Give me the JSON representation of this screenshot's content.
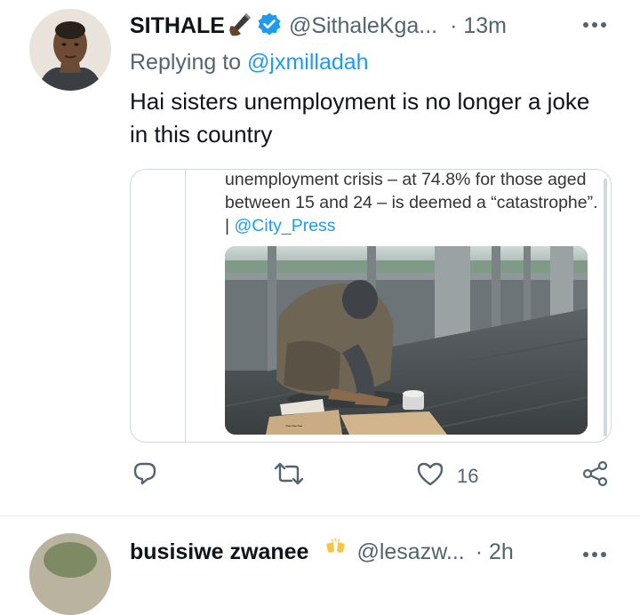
{
  "tweet": {
    "display_name": "SITHALE",
    "handle": "@SithaleKga...",
    "time": "· 13m",
    "replying_label": "Replying to",
    "replying_to": "@jxmilladah",
    "text": "Hai sisters unemployment is no longer a joke in this country",
    "name_emoji_icon": "writing-hand-icon",
    "verified_icon": "verified-badge-icon"
  },
  "quoted_card": {
    "text": "unemployment crisis – at 74.8% for those aged between 15 and 24 – is deemed a “catastrophe”. | ",
    "mention": "@City_Press"
  },
  "actions": {
    "like_count": "16"
  },
  "next_tweet": {
    "display_name": "busisiwe zwanee",
    "handle": "@lesazw...",
    "time": "· 2h"
  },
  "colors": {
    "accent": "#1d9bf0",
    "secondary_text": "#536471",
    "border": "#cfd9de"
  }
}
